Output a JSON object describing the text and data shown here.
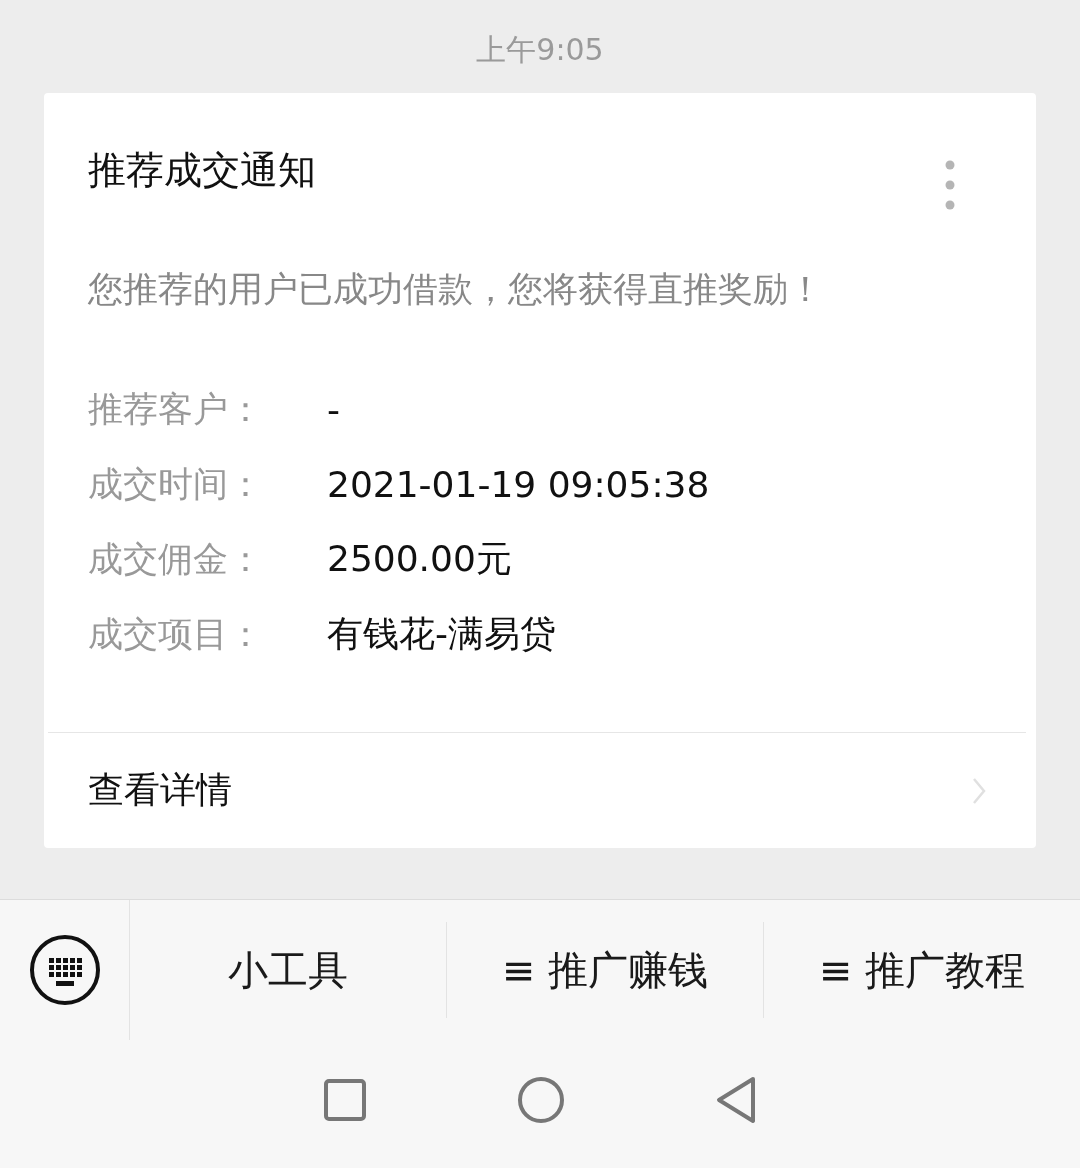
{
  "timestamp": "上午9:05",
  "card": {
    "title": "推荐成交通知",
    "message": "您推荐的用户已成功借款，您将获得直推奖励！",
    "fields": [
      {
        "label": "推荐客户：",
        "value": "-"
      },
      {
        "label": "成交时间：",
        "value": "2021-01-19 09:05:38"
      },
      {
        "label": "成交佣金：",
        "value": "2500.00元"
      },
      {
        "label": "成交项目：",
        "value": "有钱花-满易贷"
      }
    ],
    "footer_link": "查看详情"
  },
  "menu_bar": {
    "items": [
      {
        "label": "小工具"
      },
      {
        "label": "≡ 推广赚钱"
      },
      {
        "label": "≡ 推广教程"
      }
    ]
  }
}
